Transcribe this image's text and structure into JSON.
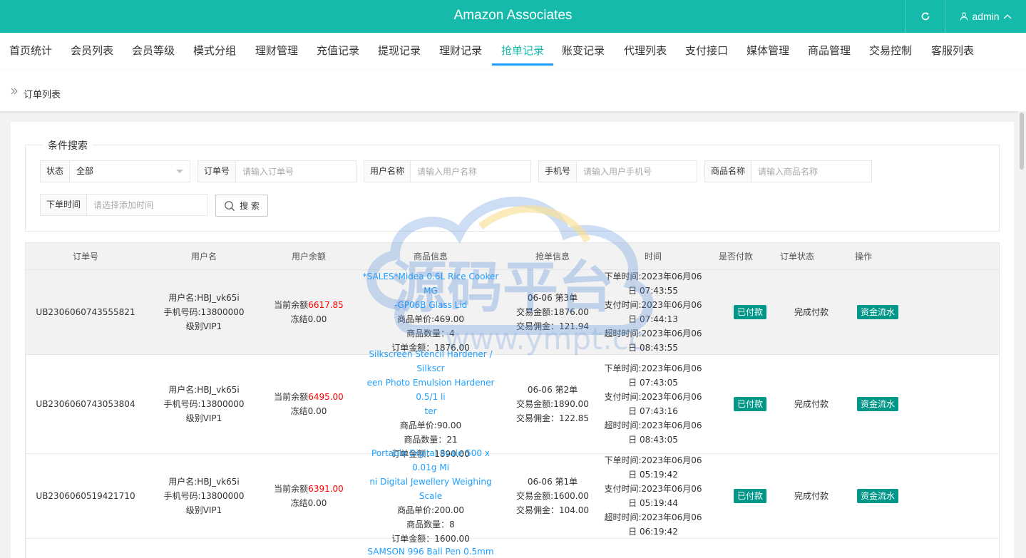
{
  "header": {
    "title": "Amazon Associates",
    "user": "admin"
  },
  "nav": {
    "items": [
      "首页统计",
      "会员列表",
      "会员等级",
      "模式分组",
      "理财管理",
      "充值记录",
      "提现记录",
      "理财记录",
      "抢单记录",
      "账变记录",
      "代理列表",
      "支付接口",
      "媒体管理",
      "商品管理",
      "交易控制",
      "客服列表"
    ],
    "active_index": 8
  },
  "breadcrumb": "订单列表",
  "search": {
    "legend": "条件搜索",
    "status": {
      "label": "状态",
      "value": "全部"
    },
    "order_no": {
      "label": "订单号",
      "placeholder": "请输入订单号"
    },
    "username": {
      "label": "用户名称",
      "placeholder": "请输入用户名称"
    },
    "phone": {
      "label": "手机号",
      "placeholder": "请输入用户手机号"
    },
    "product": {
      "label": "商品名称",
      "placeholder": "请输入商品名称"
    },
    "order_time": {
      "label": "下单时间",
      "placeholder": "请选择添加时间"
    },
    "button": "搜 索"
  },
  "table": {
    "headers": [
      "订单号",
      "用户名",
      "用户余额",
      "商品信息",
      "抢单信息",
      "时间",
      "是否付款",
      "订单状态",
      "操作"
    ],
    "rows": [
      {
        "order_no": "UB2306060743555821",
        "user_name": "用户名:HBJ_vk65i",
        "user_phone": "手机号码:13800000",
        "user_level": "级别VIP1",
        "balance_label": "当前余额",
        "balance": "6617.85",
        "frozen": "冻结0.00",
        "product_name_lines": [
          "*SALES*Midea 0.6L Rice Cooker MG",
          "-GP06B Glass Lid"
        ],
        "unit_price": "商品单价:469.00",
        "qty": "商品数量：4",
        "amount": "订单金额：1876.00",
        "grab_seq": "06-06 第3单",
        "trade_amount": "交易金额:1876.00",
        "commission": "交易佣金：121.94",
        "time_order": "下单时间:2023年06月06日 07:43:55",
        "time_pay": "支付时间:2023年06月06日 07:44:13",
        "time_expire": "超时时间:2023年06月06日 08:43:55",
        "paid": "已付款",
        "status": "完成付款",
        "action": "资金流水"
      },
      {
        "order_no": "UB2306060743053804",
        "user_name": "用户名:HBJ_vk65i",
        "user_phone": "手机号码:13800000",
        "user_level": "级别VIP1",
        "balance_label": "当前余额",
        "balance": "6495.00",
        "frozen": "冻结0.00",
        "product_name_lines": [
          "Silkscreen Stencil Hardener / Silkscr",
          "een Photo Emulsion Hardener 0.5/1 li",
          "ter"
        ],
        "unit_price": "商品单价:90.00",
        "qty": "商品数量：21",
        "amount": "订单金额：1890.00",
        "grab_seq": "06-06 第2单",
        "trade_amount": "交易金额:1890.00",
        "commission": "交易佣金：122.85",
        "time_order": "下单时间:2023年06月06日 07:43:05",
        "time_pay": "支付时间:2023年06月06日 07:43:16",
        "time_expire": "超时时间:2023年06月06日 08:43:05",
        "paid": "已付款",
        "status": "完成付款",
        "action": "资金流水"
      },
      {
        "order_no": "UB2306060519421710",
        "user_name": "用户名:HBJ_vk65i",
        "user_phone": "手机号码:13800000",
        "user_level": "级别VIP1",
        "balance_label": "当前余额",
        "balance": "6391.00",
        "frozen": "冻结0.00",
        "product_name_lines": [
          "Portable Digital Scale 500 x 0.01g Mi",
          "ni Digital Jewellery Weighing Scale"
        ],
        "unit_price": "商品单价:200.00",
        "qty": "商品数量：8",
        "amount": "订单金额：1600.00",
        "grab_seq": "06-06 第1单",
        "trade_amount": "交易金额:1600.00",
        "commission": "交易佣金：104.00",
        "time_order": "下单时间:2023年06月06日 05:19:42",
        "time_pay": "支付时间:2023年06月06日 05:19:44",
        "time_expire": "超时时间:2023年06月06日 06:19:42",
        "paid": "已付款",
        "status": "完成付款",
        "action": "资金流水"
      },
      {
        "order_no": "",
        "user_name": "",
        "user_phone": "",
        "user_level": "",
        "balance_label": "",
        "balance": "",
        "frozen": "",
        "product_name_lines": [
          "SAMSON 996 Ball Pen 0.5mm"
        ],
        "unit_price": "",
        "qty": "",
        "amount": "",
        "grab_seq": "",
        "trade_amount": "",
        "commission": "",
        "time_order": "",
        "time_pay": "",
        "time_expire": "",
        "paid": "",
        "status": "",
        "action": ""
      }
    ]
  },
  "watermark": {
    "title": "源码平台",
    "url": "www.ympt.cc"
  },
  "colors": {
    "header_bg": "#16baaa",
    "active_tab": "#16baaa",
    "tab_underline": "#1e9fff",
    "badge_bg": "#009688",
    "link": "#1e9fff",
    "balance": "#ff0000"
  },
  "icons": {
    "refresh": "refresh-icon",
    "user": "user-icon",
    "caret": "chevron-up-icon",
    "breadcrumb": "double-chevron-right-icon",
    "search": "search-icon",
    "select": "triangle-down-icon"
  }
}
